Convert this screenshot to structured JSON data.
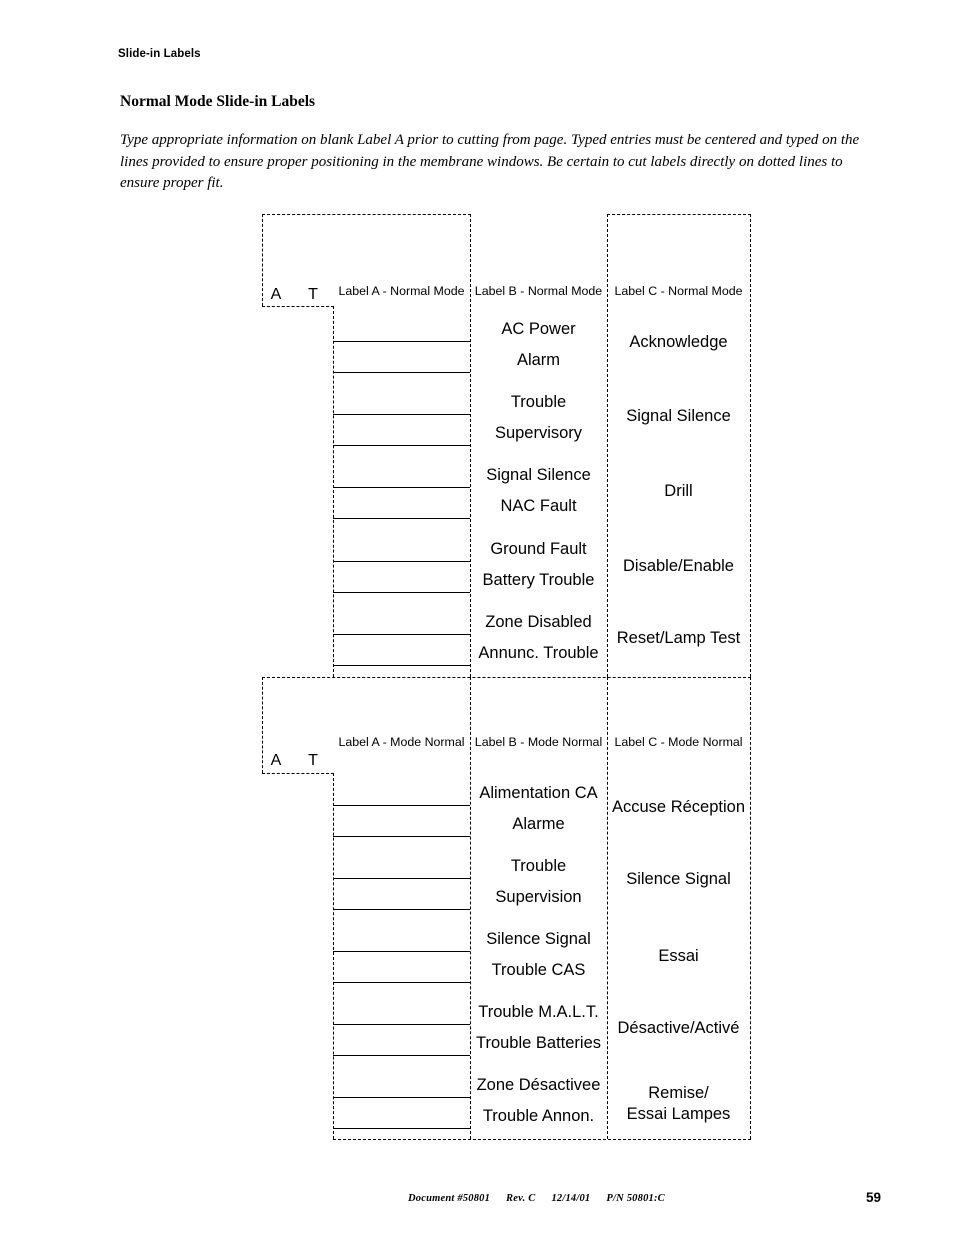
{
  "running_head": "Slide-in Labels",
  "section_title": "Normal Mode Slide-in Labels",
  "intro_text": "Type appropriate information on blank Label A prior to cutting from page.  Typed entries must be centered and typed on the lines provided to ensure proper positioning in the membrane windows.  Be certain to cut labels directly on dotted lines to ensure proper fit.",
  "sections": [
    {
      "id": "normal-mode-english",
      "corner_marks": [
        "A",
        "T"
      ],
      "headers": {
        "label_a": "Label A - Normal Mode",
        "label_b": "Label B - Normal Mode",
        "label_c": "Label C - Normal Mode"
      },
      "label_b_entries": [
        "AC Power",
        "Alarm",
        "Trouble",
        "Supervisory",
        "Signal Silence",
        "NAC Fault",
        "Ground Fault",
        "Battery Trouble",
        "Zone Disabled",
        "Annunc. Trouble"
      ],
      "label_c_entries": [
        "Acknowledge",
        "Signal Silence",
        "Drill",
        "Disable/Enable",
        "Reset/Lamp Test"
      ],
      "label_a_blank_line_count": 10
    },
    {
      "id": "normal-mode-french",
      "corner_marks": [
        "A",
        "T"
      ],
      "headers": {
        "label_a": "Label A - Mode Normal",
        "label_b": "Label B - Mode Normal",
        "label_c": "Label C - Mode Normal"
      },
      "label_b_entries": [
        "Alimentation CA",
        "Alarme",
        "Trouble",
        "Supervision",
        "Silence Signal",
        "Trouble CAS",
        "Trouble M.A.L.T.",
        "Trouble Batteries",
        "Zone Désactivee",
        "Trouble Annon."
      ],
      "label_c_entries": [
        "Accuse Réception",
        "Silence Signal",
        "Essai",
        "Désactive/Activé",
        "Remise/\nEssai Lampes"
      ],
      "label_a_blank_line_count": 10
    }
  ],
  "footer": {
    "document": "Document #50801",
    "revision": "Rev. C",
    "date": "12/14/01",
    "part_number": "P/N 50801:C",
    "page_number": "59"
  }
}
